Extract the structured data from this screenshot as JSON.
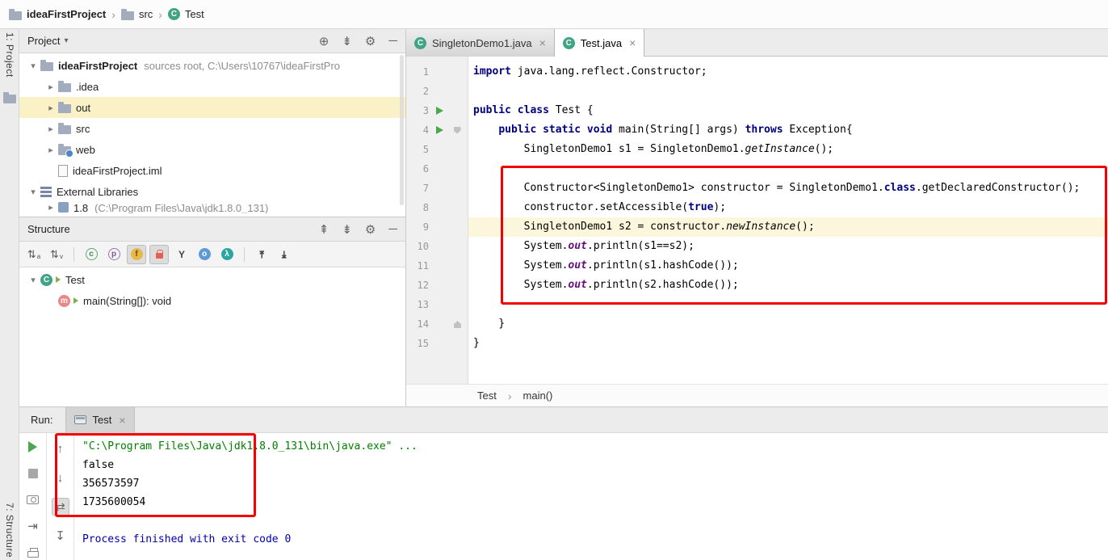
{
  "colors": {
    "annotation_red": "#F50000",
    "keyword_blue": "#000080",
    "static_field_purple": "#660E7A",
    "console_command_green": "#008000",
    "console_plain": "#000000",
    "console_system_blue": "#0000B2",
    "run_green": "#4CA64C",
    "caret_line": "#FCF6DC",
    "selected_row_yellow": "#FAF1C6"
  },
  "icons": {
    "glyphs": {
      "chevron-right": "▸",
      "chevron-down": "▾",
      "breadcrumb-sep": "›",
      "panel-caret": "▾",
      "locate": "⊕",
      "collapse-all": "⇟",
      "expand-all": "⇞",
      "settings": "⚙",
      "hide": "─",
      "close": "×",
      "class": "C",
      "method": "m"
    }
  },
  "nav_breadcrumb": {
    "items": [
      {
        "label": "ideaFirstProject",
        "icon": "project-folder",
        "bold": true
      },
      {
        "label": "src",
        "icon": "folder",
        "bold": false
      },
      {
        "label": "Test",
        "icon": "class",
        "bold": false
      }
    ]
  },
  "tool_stripes": {
    "top_left": "1: Project",
    "bottom_left": "7: Structure"
  },
  "project_panel": {
    "title": "Project",
    "header_icons": [
      "locate",
      "collapse-all",
      "settings",
      "hide"
    ],
    "tree": [
      {
        "level": 0,
        "chevron": "down",
        "icon": "project-folder",
        "label": "ideaFirstProject",
        "bold": true,
        "annotation": "sources root,  C:\\Users\\10767\\ideaFirstPro"
      },
      {
        "level": 1,
        "chevron": "right",
        "icon": "folder",
        "label": ".idea"
      },
      {
        "level": 1,
        "chevron": "right",
        "icon": "folder",
        "label": "out",
        "highlight": true
      },
      {
        "level": 1,
        "chevron": "right",
        "icon": "folder",
        "label": "src"
      },
      {
        "level": 1,
        "chevron": "right",
        "icon": "folder-web",
        "label": "web"
      },
      {
        "level": 1,
        "chevron": "none",
        "icon": "file",
        "label": "ideaFirstProject.iml"
      },
      {
        "level": 0,
        "chevron": "down",
        "icon": "library",
        "label": "External Libraries"
      },
      {
        "level": 1,
        "chevron": "right",
        "icon": "jdk",
        "label": "1.8",
        "annotation": "(C:\\Program Files\\Java\\jdk1.8.0_131)",
        "clipped": true
      }
    ]
  },
  "structure_panel": {
    "title": "Structure",
    "header_icons": [
      "expand-all",
      "collapse-all",
      "settings",
      "hide"
    ],
    "toolbar": [
      {
        "name": "sort-alphabetically",
        "glyph": "⇅",
        "sub": "a"
      },
      {
        "name": "sort-by-visibility",
        "glyph": "⇅",
        "sub": "v",
        "gap": true
      },
      {
        "name": "show-classes",
        "glyph": "c",
        "cls": "circ green"
      },
      {
        "name": "show-properties",
        "glyph": "p",
        "cls": "circ purple"
      },
      {
        "name": "show-fields",
        "glyph": "f",
        "cls": "circ orange",
        "toggled": true
      },
      {
        "name": "show-non-public",
        "cls": "lock",
        "toggled": true
      },
      {
        "name": "group-by-inheritance",
        "glyph": "Y",
        "cls": "plainY"
      },
      {
        "name": "show-anonymous-classes",
        "glyph": "o",
        "cls": "circ bluefill"
      },
      {
        "name": "show-lambdas",
        "glyph": "λ",
        "cls": "circ tealfill",
        "gap": true
      },
      {
        "name": "autoscroll-to-source",
        "glyph": "⇥",
        "cls": "plainY",
        "rot": "rotm90"
      },
      {
        "name": "autoscroll-from-source",
        "glyph": "⇥",
        "cls": "plainY",
        "rot": "rot90"
      }
    ],
    "tree": [
      {
        "level": 0,
        "chevron": "down",
        "icon": "class",
        "marker": true,
        "label": "Test"
      },
      {
        "level": 1,
        "chevron": "none",
        "icon": "method",
        "marker": true,
        "label": "main(String[]): void"
      }
    ]
  },
  "editor": {
    "tabs": [
      {
        "label": "SingletonDemo1.java",
        "active": false
      },
      {
        "label": "Test.java",
        "active": true
      }
    ],
    "breadcrumbs": [
      "Test",
      "main()"
    ],
    "code": [
      {
        "n": 1,
        "tokens": [
          [
            "kw",
            "import"
          ],
          [
            "pl",
            " java.lang.reflect.Constructor;"
          ]
        ]
      },
      {
        "n": 2,
        "tokens": []
      },
      {
        "n": 3,
        "run": true,
        "tokens": [
          [
            "kw",
            "public class"
          ],
          [
            "pl",
            " Test {"
          ]
        ]
      },
      {
        "n": 4,
        "run": true,
        "fold": "down",
        "tokens": [
          [
            "pl",
            "    "
          ],
          [
            "kw",
            "public static void"
          ],
          [
            "pl",
            " main(String[] args) "
          ],
          [
            "kw",
            "throws"
          ],
          [
            "pl",
            " Exception{"
          ]
        ]
      },
      {
        "n": 5,
        "tokens": [
          [
            "pl",
            "        SingletonDemo1 s1 = SingletonDemo1."
          ],
          [
            "sm",
            "getInstance"
          ],
          [
            "pl",
            "();"
          ]
        ]
      },
      {
        "n": 6,
        "tokens": []
      },
      {
        "n": 7,
        "tokens": [
          [
            "pl",
            "        Constructor<SingletonDemo1> constructor = SingletonDemo1."
          ],
          [
            "kw",
            "class"
          ],
          [
            "pl",
            ".getDeclaredConstructor();"
          ]
        ]
      },
      {
        "n": 8,
        "tokens": [
          [
            "pl",
            "        constructor.setAccessible("
          ],
          [
            "kw",
            "true"
          ],
          [
            "pl",
            ");"
          ]
        ]
      },
      {
        "n": 9,
        "caret": true,
        "tokens": [
          [
            "pl",
            "        SingletonDemo1 s2 = constructor."
          ],
          [
            "sm",
            "newInstance"
          ],
          [
            "pl",
            "();"
          ]
        ]
      },
      {
        "n": 10,
        "tokens": [
          [
            "pl",
            "        System."
          ],
          [
            "sf",
            "out"
          ],
          [
            "pl",
            ".println(s1==s2);"
          ]
        ]
      },
      {
        "n": 11,
        "tokens": [
          [
            "pl",
            "        System."
          ],
          [
            "sf",
            "out"
          ],
          [
            "pl",
            ".println(s1.hashCode());"
          ]
        ]
      },
      {
        "n": 12,
        "tokens": [
          [
            "pl",
            "        System."
          ],
          [
            "sf",
            "out"
          ],
          [
            "pl",
            ".println(s2.hashCode());"
          ]
        ]
      },
      {
        "n": 13,
        "tokens": []
      },
      {
        "n": 14,
        "fold": "up",
        "tokens": [
          [
            "pl",
            "    }"
          ]
        ]
      },
      {
        "n": 15,
        "tokens": [
          [
            "pl",
            "}"
          ]
        ]
      }
    ]
  },
  "run_panel": {
    "label": "Run:",
    "tab": {
      "label": "Test"
    },
    "toolbar_main": [
      {
        "name": "rerun",
        "shape": "play"
      },
      {
        "name": "stop",
        "shape": "stopsq"
      },
      {
        "name": "thread-dump",
        "shape": "camera"
      },
      {
        "name": "open-results",
        "glyph": "⇥"
      },
      {
        "name": "print",
        "shape": "printer"
      }
    ],
    "toolbar_console": [
      {
        "name": "prev-occurrence",
        "glyph": "↑"
      },
      {
        "name": "next-occurrence",
        "glyph": "↓"
      },
      {
        "name": "soft-wrap",
        "glyph": "⇄",
        "toggled": true
      },
      {
        "name": "scroll-to-end",
        "glyph": "↧"
      }
    ],
    "console": [
      {
        "text": "\"C:\\Program Files\\Java\\jdk1.8.0_131\\bin\\java.exe\" ...",
        "color": "command"
      },
      {
        "text": "false",
        "color": "plain"
      },
      {
        "text": "356573597",
        "color": "plain"
      },
      {
        "text": "1735600054",
        "color": "plain"
      },
      {
        "text": "",
        "color": "plain"
      },
      {
        "text": "Process finished with exit code 0",
        "color": "system"
      }
    ]
  }
}
